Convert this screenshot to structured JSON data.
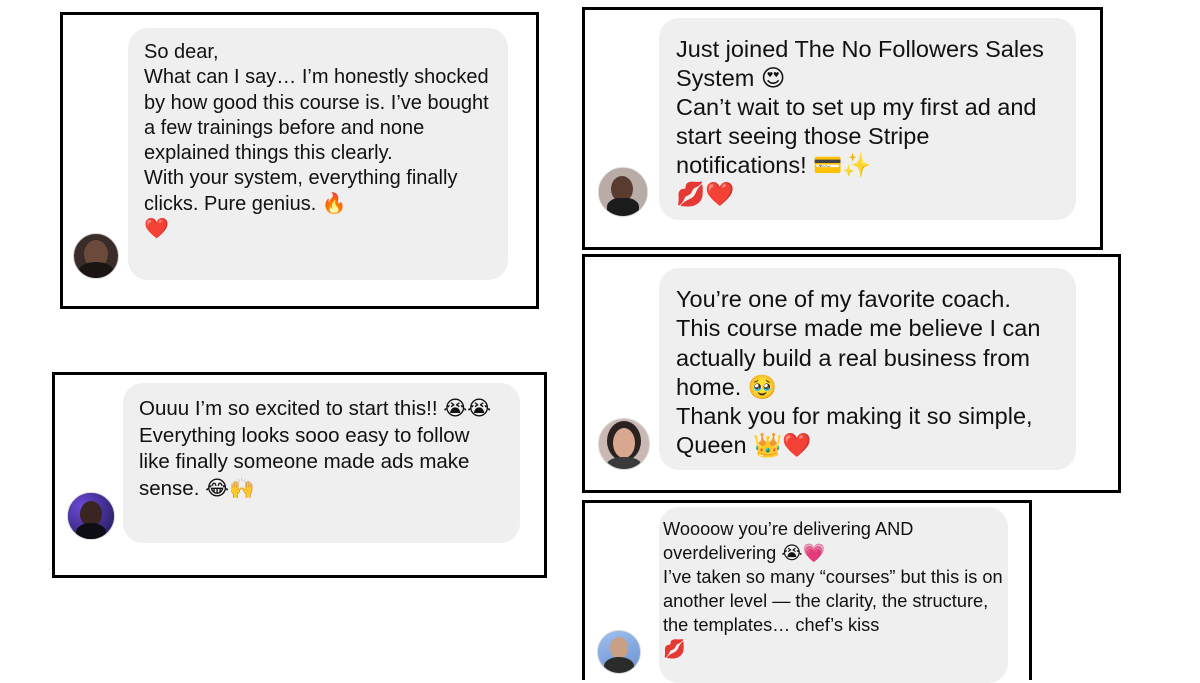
{
  "messages": [
    {
      "avatar": "avatar-1",
      "text": "So dear,\nWhat can I say… I’m honestly shocked by how good this course is. I’ve bought a few trainings before and none explained things this clearly.\nWith your system, everything finally clicks. Pure genius. 🔥\n❤️"
    },
    {
      "avatar": "avatar-2",
      "text": "Just joined The No Followers Sales System 😍\nCan’t wait to set up my first ad and start seeing those Stripe notifications! 💳✨\n💋❤️"
    },
    {
      "avatar": "avatar-3",
      "text": "You’re one of my favorite coach.\nThis course made me believe I can actually build a real business from home. 🥹\nThank you for making it so simple, Queen 👑❤️"
    },
    {
      "avatar": "avatar-4",
      "text": "Ouuu I’m so excited to start this!! 😭😭\nEverything looks sooo easy to follow like finally someone made ads make sense. 😂🙌"
    },
    {
      "avatar": "avatar-5",
      "text": "Woooow you’re delivering AND overdelivering 😭💗\nI’ve taken so many “courses” but this is on another level — the clarity, the structure, the templates… chef’s kiss\n💋"
    }
  ],
  "colors": {
    "border": "#000000",
    "bubble": "#efefef",
    "text": "#111111",
    "background": "#ffffff"
  }
}
